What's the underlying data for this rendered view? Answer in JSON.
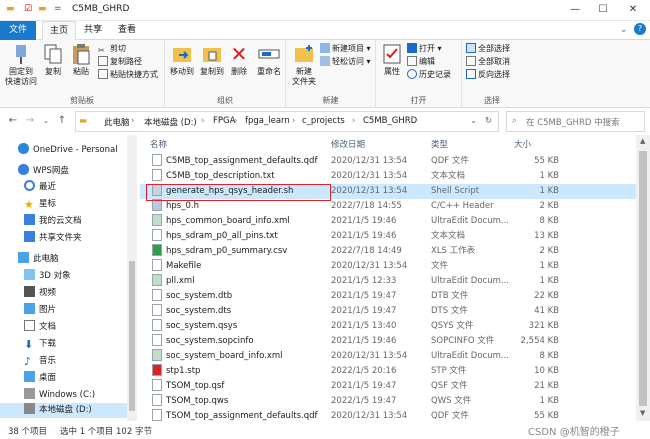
{
  "window": {
    "title": "C5MB_GHRD",
    "minimize": "—",
    "maximize": "☐",
    "close": "✕"
  },
  "tabs": [
    "文件",
    "主页",
    "共享",
    "查看"
  ],
  "ribbon": {
    "pin_label": "固定到\n快速访问",
    "copy_label": "复制",
    "paste_label": "粘贴",
    "cut_label": "剪切",
    "copy_path_label": "复制路径",
    "paste_shortcut_label": "粘贴快捷方式",
    "clipboard_group": "剪贴板",
    "move_label": "移动到",
    "copy_to_label": "复制到",
    "delete_label": "删除",
    "rename_label": "重命名",
    "organize_group": "组织",
    "new_item_label": "新建项目 ▾",
    "easy_access_label": "轻松访问 ▾",
    "new_folder_label": "新建\n文件夹",
    "new_group": "新建",
    "properties_label": "属性",
    "open_label": "打开 ▾",
    "edit_label": "编辑",
    "history_label": "历史记录",
    "open_group": "打开",
    "select_all_label": "全部选择",
    "select_none_label": "全部取消",
    "invert_label": "反向选择",
    "select_group": "选择"
  },
  "address": {
    "crumbs": [
      "此电脑",
      "本地磁盘 (D:)",
      "FPGA",
      "fpga_learn",
      "c_projects",
      "C5MB_GHRD"
    ],
    "search_placeholder": "在 C5MB_GHRD 中搜索"
  },
  "nav": {
    "items": [
      "OneDrive - Personal",
      "WPS网盘",
      "最近",
      "星标",
      "我的云文档",
      "共享文件夹",
      "此电脑",
      "3D 对象",
      "视频",
      "图片",
      "文档",
      "下载",
      "音乐",
      "桌面",
      "Windows (C:)",
      "本地磁盘 (D:)"
    ]
  },
  "columns": {
    "name": "名称",
    "date": "修改日期",
    "type": "类型",
    "size": "大小"
  },
  "files": [
    {
      "name": "C5MB_top_assignment_defaults.qdf",
      "date": "2020/12/31 13:54",
      "type": "QDF 文件",
      "size": "55 KB"
    },
    {
      "name": "C5MB_top_description.txt",
      "date": "2020/12/31 13:54",
      "type": "文本文档",
      "size": "1 KB"
    },
    {
      "name": "generate_hps_qsys_header.sh",
      "date": "2020/12/31 13:54",
      "type": "Shell Script",
      "size": "1 KB"
    },
    {
      "name": "hps_0.h",
      "date": "2022/7/18 14:55",
      "type": "C/C++ Header",
      "size": "2 KB"
    },
    {
      "name": "hps_common_board_info.xml",
      "date": "2021/1/5 19:46",
      "type": "UltraEdit Docum...",
      "size": "8 KB"
    },
    {
      "name": "hps_sdram_p0_all_pins.txt",
      "date": "2021/1/5 19:46",
      "type": "文本文档",
      "size": "13 KB"
    },
    {
      "name": "hps_sdram_p0_summary.csv",
      "date": "2022/7/18 14:49",
      "type": "XLS 工作表",
      "size": "2 KB"
    },
    {
      "name": "Makefile",
      "date": "2020/12/31 13:54",
      "type": "文件",
      "size": "1 KB"
    },
    {
      "name": "pll.xml",
      "date": "2021/1/5 12:33",
      "type": "UltraEdit Docum...",
      "size": "1 KB"
    },
    {
      "name": "soc_system.dtb",
      "date": "2021/1/5 19:47",
      "type": "DTB 文件",
      "size": "22 KB"
    },
    {
      "name": "soc_system.dts",
      "date": "2021/1/5 19:47",
      "type": "DTS 文件",
      "size": "41 KB"
    },
    {
      "name": "soc_system.qsys",
      "date": "2021/1/5 13:40",
      "type": "QSYS 文件",
      "size": "321 KB"
    },
    {
      "name": "soc_system.sopcinfo",
      "date": "2021/1/5 19:46",
      "type": "SOPCINFO 文件",
      "size": "2,554 KB"
    },
    {
      "name": "soc_system_board_info.xml",
      "date": "2020/12/31 13:54",
      "type": "UltraEdit Docum...",
      "size": "8 KB"
    },
    {
      "name": "stp1.stp",
      "date": "2022/1/5 20:16",
      "type": "STP 文件",
      "size": "10 KB"
    },
    {
      "name": "TSOM_top.qsf",
      "date": "2021/1/5 19:47",
      "type": "QSF 文件",
      "size": "21 KB"
    },
    {
      "name": "TSOM_top.qws",
      "date": "2022/1/5 19:47",
      "type": "QWS 文件",
      "size": "1 KB"
    },
    {
      "name": "TSOM_top_assignment_defaults.qdf",
      "date": "2020/12/31 13:54",
      "type": "QDF 文件",
      "size": "55 KB"
    }
  ],
  "status": {
    "count": "38 个项目",
    "selected": "选中 1 个项目  102 字节"
  },
  "watermark": "CSDN @机智的橙子"
}
